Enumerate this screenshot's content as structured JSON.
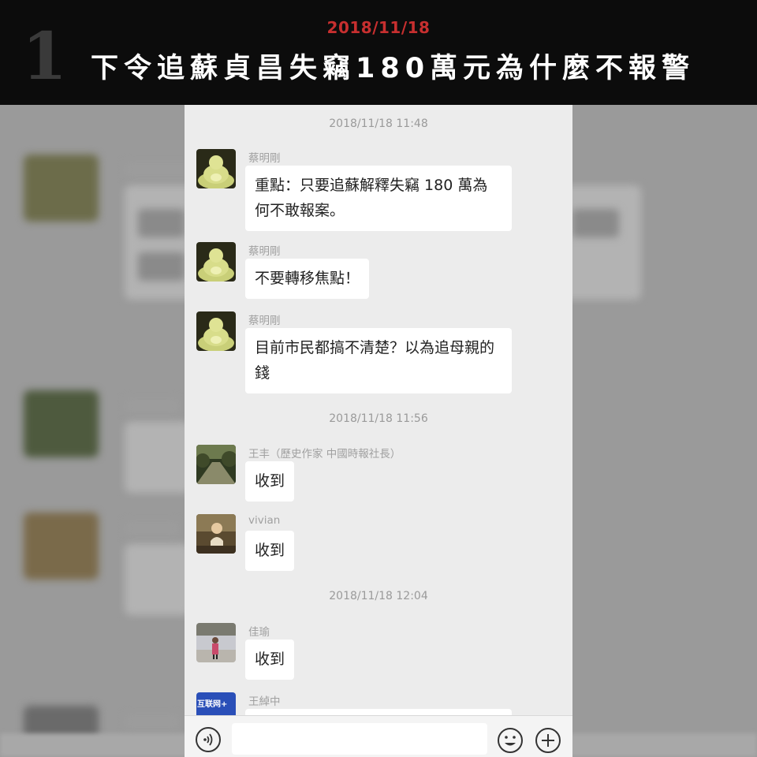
{
  "banner": {
    "episode_number": "1",
    "date": "2018/11/18",
    "title": "下令追蘇貞昌失竊180萬元為什麼不報警"
  },
  "chat": {
    "timestamps": [
      "2018/11/18 11:48",
      "2018/11/18 11:56",
      "2018/11/18 12:04"
    ],
    "messages": [
      {
        "sender": "蔡明剛",
        "avatar_icon": "golden-buddha-icon",
        "text": "重點：只要追蘇解釋失竊 180 萬為何不敢報案。"
      },
      {
        "sender": "蔡明剛",
        "avatar_icon": "golden-buddha-icon",
        "text": "不要轉移焦點！"
      },
      {
        "sender": "蔡明剛",
        "avatar_icon": "golden-buddha-icon",
        "text": "目前市民都搞不清楚？以為追母親的錢"
      },
      {
        "sender": "王丰（歷史作家 中國時報社長）",
        "avatar_icon": "forest-path-photo-icon",
        "text": "收到"
      },
      {
        "sender": "vivian",
        "avatar_icon": "woman-at-desk-photo-icon",
        "text": "收到"
      },
      {
        "sender": "佳瑜",
        "avatar_icon": "person-outdoor-photo-icon",
        "text": "收到"
      },
      {
        "sender": "王綽中",
        "avatar_icon": "internet-plus-logo-icon",
        "avatar_text": "互联网+",
        "text": ""
      }
    ]
  },
  "input_bar": {
    "voice_icon": "voice-icon",
    "emoji_icon": "smiley-icon",
    "plus_icon": "plus-icon",
    "input_value": ""
  },
  "colors": {
    "banner_bg": "#0c0c0c",
    "date_red": "#c72f2f",
    "chat_bg": "#ececec",
    "bubble_bg": "#ffffff"
  }
}
